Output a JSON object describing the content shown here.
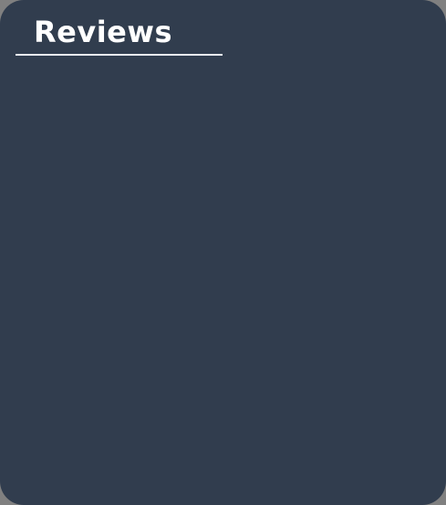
{
  "reviews": {
    "title": "Reviews"
  },
  "colors": {
    "card_background": "#313d4e",
    "title_text": "#ffffff",
    "underline": "#e9edf3",
    "outer_background": "#808080"
  }
}
